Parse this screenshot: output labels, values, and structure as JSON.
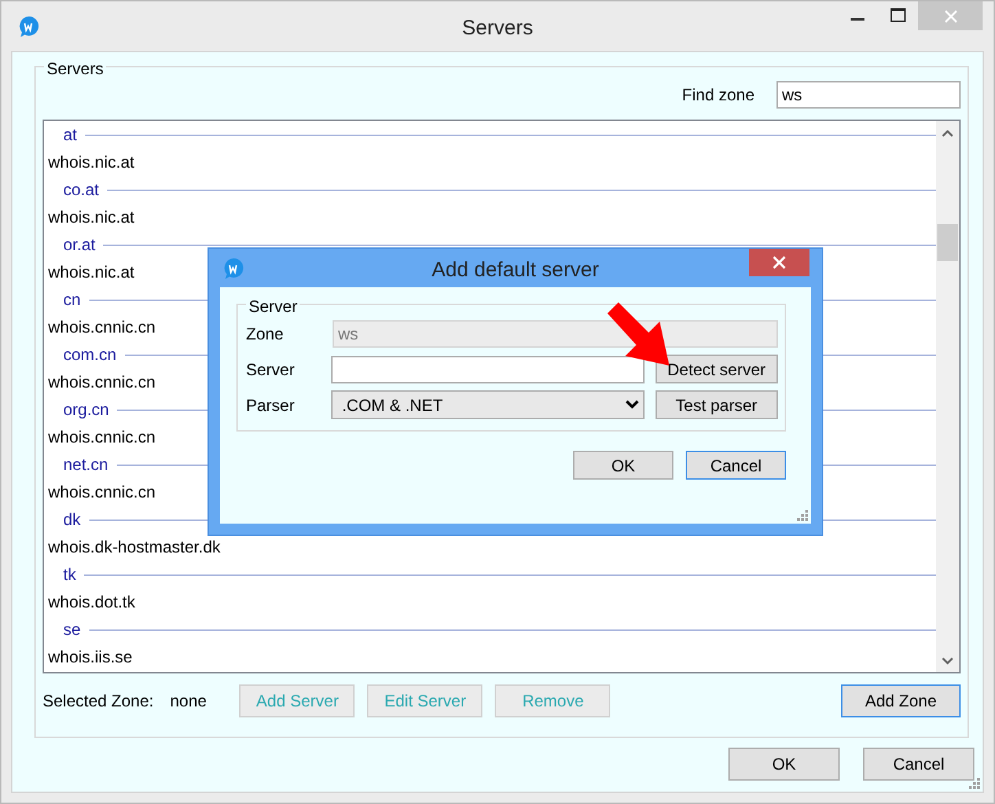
{
  "window": {
    "title": "Servers"
  },
  "group_label": "Servers",
  "find_zone": {
    "label": "Find zone",
    "value": "ws"
  },
  "zones": [
    {
      "zone": "at",
      "server": "whois.nic.at"
    },
    {
      "zone": "co.at",
      "server": "whois.nic.at"
    },
    {
      "zone": "or.at",
      "server": "whois.nic.at"
    },
    {
      "zone": "cn",
      "server": "whois.cnnic.cn"
    },
    {
      "zone": "com.cn",
      "server": "whois.cnnic.cn"
    },
    {
      "zone": "org.cn",
      "server": "whois.cnnic.cn"
    },
    {
      "zone": "net.cn",
      "server": "whois.cnnic.cn"
    },
    {
      "zone": "dk",
      "server": "whois.dk-hostmaster.dk"
    },
    {
      "zone": "tk",
      "server": "whois.dot.tk"
    },
    {
      "zone": "se",
      "server": "whois.iis.se"
    }
  ],
  "selected_zone": {
    "label": "Selected Zone:",
    "value": "none"
  },
  "zone_buttons": [
    {
      "label": "Add Server",
      "disabled": true
    },
    {
      "label": "Edit Server",
      "disabled": true
    },
    {
      "label": "Remove",
      "disabled": true
    }
  ],
  "add_zone_button": {
    "label": "Add Zone",
    "focused": true
  },
  "footer_buttons": [
    {
      "label": "OK",
      "focused": false
    },
    {
      "label": "Cancel",
      "focused": false
    }
  ],
  "dialog": {
    "title": "Add default server",
    "group_label": "Server",
    "fields": [
      {
        "kind": "text",
        "label": "Zone",
        "value": "ws",
        "disabled": true
      },
      {
        "kind": "text",
        "label": "Server",
        "disabled": false,
        "button": "Detect server"
      },
      {
        "kind": "select",
        "label": "Parser",
        "value": ".COM & .NET",
        "disabled": false,
        "button": "Test parser"
      }
    ],
    "buttons": [
      {
        "label": "OK",
        "focused": false
      },
      {
        "label": "Cancel",
        "focused": true
      }
    ]
  }
}
